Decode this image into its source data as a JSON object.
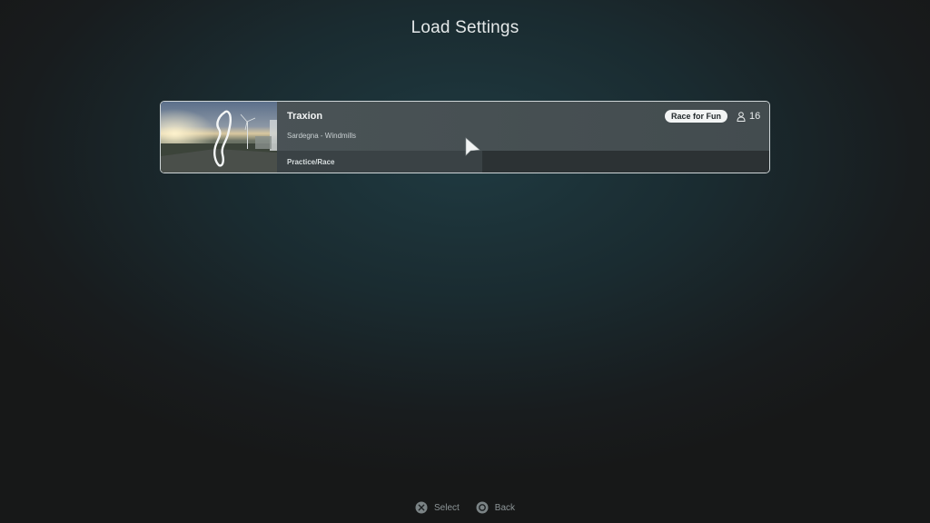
{
  "page": {
    "title": "Load Settings"
  },
  "setting": {
    "name": "Traxion",
    "track": "Sardegna - Windmills",
    "mode": "Practice/Race",
    "badge": "Race for Fun",
    "player_count": "16",
    "player_icon": "person-icon",
    "thumbnail_icon": "track-layout-thumbnail"
  },
  "footer": {
    "select_label": "Select",
    "select_icon": "cross-button-icon",
    "back_label": "Back",
    "back_icon": "circle-button-icon"
  },
  "colors": {
    "background": "#181c1e",
    "card_border": "#cfd6d8",
    "badge_background": "#f2f4f4"
  }
}
